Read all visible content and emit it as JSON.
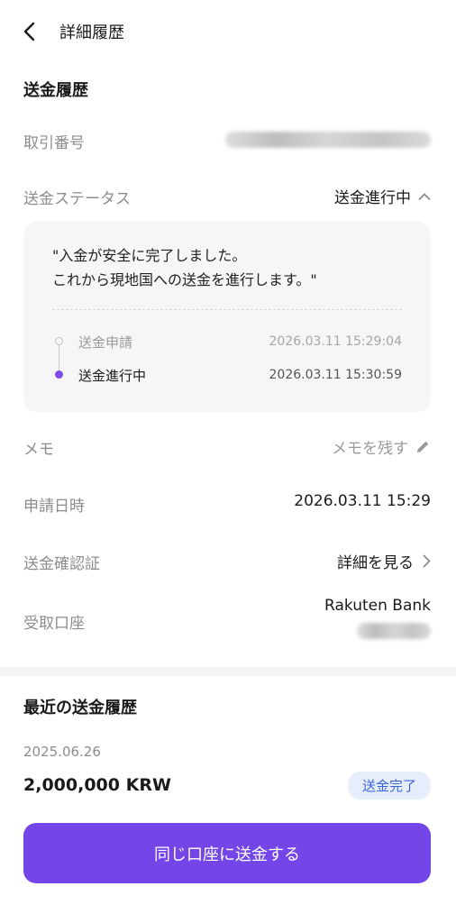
{
  "header": {
    "title": "詳細履歴"
  },
  "transfer": {
    "section_title": "送金履歴",
    "txn_label": "取引番号",
    "status_label": "送金ステータス",
    "status_value": "送金進行中",
    "status_message_line1": "\"入金が安全に完了しました。",
    "status_message_line2": "これから現地国への送金を進行します。\"",
    "timeline": [
      {
        "label": "送金申請",
        "time": "2026.03.11 15:29:04"
      },
      {
        "label": "送金進行中",
        "time": "2026.03.11 15:30:59"
      }
    ],
    "memo_label": "メモ",
    "memo_action": "メモを残す",
    "request_date_label": "申請日時",
    "request_date_value": "2026.03.11 15:29",
    "certificate_label": "送金確認証",
    "certificate_action": "詳細を見る",
    "account_label": "受取口座",
    "account_bank": "Rakuten Bank"
  },
  "recent": {
    "section_title": "最近の送金履歴",
    "date": "2025.06.26",
    "amount": "2,000,000 KRW",
    "status": "送金完了"
  },
  "cta": {
    "label": "同じ口座に送金する"
  },
  "colors": {
    "accent": "#7446e8",
    "timeline_active": "#7a4ce8",
    "badge_bg": "#e7eefb",
    "badge_text": "#3b64d6"
  }
}
